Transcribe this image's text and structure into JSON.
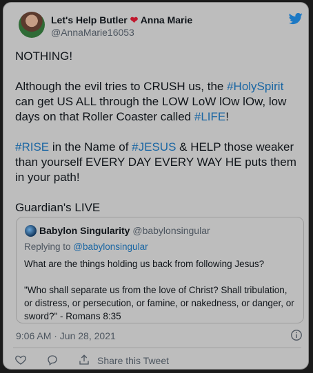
{
  "author": {
    "name_part1": "Let's Help Butler",
    "heart": "❤️",
    "name_part2": "Anna Marie",
    "handle": "@AnnaMarie16053"
  },
  "tweet": {
    "p1": "NOTHING!",
    "p2a": "Although the evil tries to CRUSH us, the ",
    "p2_tag1": "#HolySpirit",
    "p2b": " can get US ALL through the LOW LoW lOw lOw, low days on that Roller Coaster called ",
    "p2_tag2": "#LIFE",
    "p2c": "!",
    "p3_tag1": "#RISE",
    "p3a": " in the Name of ",
    "p3_tag2": "#JESUS",
    "p3b": " & HELP those weaker than yourself EVERY DAY EVERY WAY HE puts them in your path!",
    "p4": "Guardian's LIVE"
  },
  "quote": {
    "name": "Babylon Singularity",
    "handle": "@babylonsingular",
    "replying_prefix": "Replying to ",
    "replying_to": "@babylonsingular",
    "line1": "What are the things holding us back from following Jesus?",
    "line2": "\"Who shall separate us from the love of Christ? Shall tribulation, or distress, or persecution, or famine, or nakedness, or danger, or sword?\" - Romans 8:35"
  },
  "meta": {
    "timestamp": "9:06 AM · Jun 28, 2021"
  },
  "actions": {
    "like_icon": "heart-outline-icon",
    "reply_icon": "speech-bubble-icon",
    "share_icon": "share-upload-icon",
    "share_label": "Share this Tweet"
  },
  "colors": {
    "card_bg": "#bdbdbd",
    "hashtag": "#1a66a3",
    "twitter_blue": "#1d79c4"
  }
}
